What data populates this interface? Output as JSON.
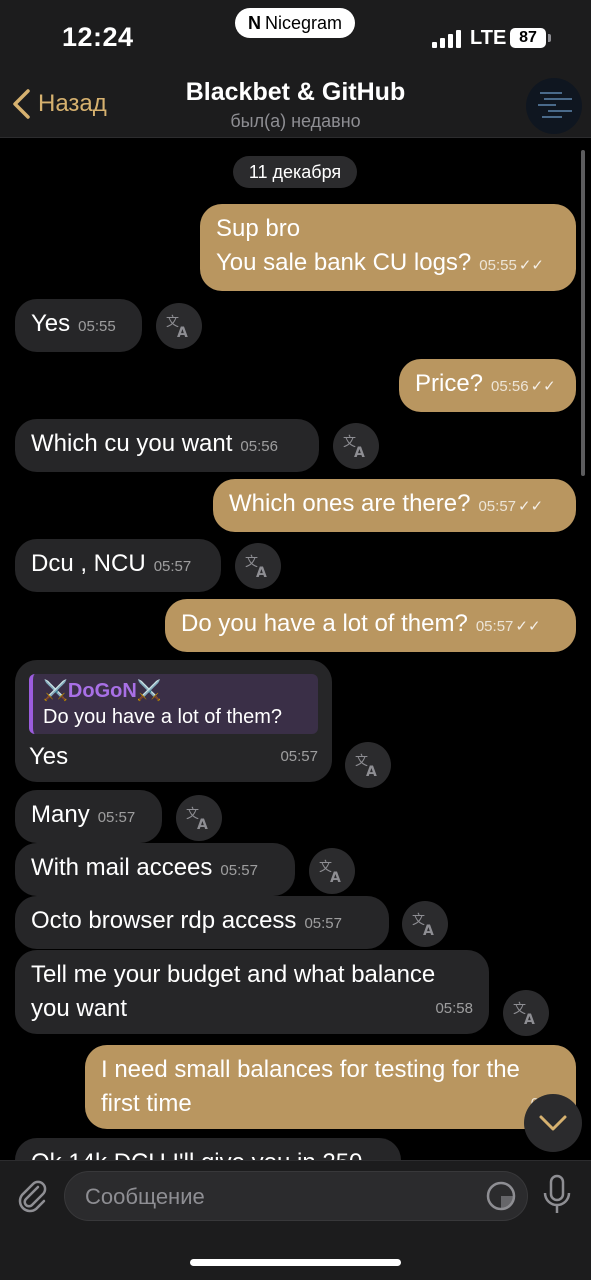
{
  "status_bar": {
    "time": "12:24",
    "app_badge": "Nicegram",
    "network": "LTE",
    "battery": "87"
  },
  "header": {
    "back_label": "Назад",
    "title": "Blackbet & GitHub",
    "subtitle": "был(а) недавно"
  },
  "date_chip": "11 декабря",
  "messages": [
    {
      "dir": "out",
      "lines": [
        "Sup bro",
        "You sale bank CU logs?"
      ],
      "time": "05:55"
    },
    {
      "dir": "in",
      "text": "Yes",
      "time": "05:55"
    },
    {
      "dir": "out",
      "text": "Price?",
      "time": "05:56"
    },
    {
      "dir": "in",
      "text": "Which cu you want",
      "time": "05:56"
    },
    {
      "dir": "out",
      "text": "Which ones are there?",
      "time": "05:57"
    },
    {
      "dir": "in",
      "text": "Dcu , NCU",
      "time": "05:57"
    },
    {
      "dir": "out",
      "text": "Do you have a lot of them?",
      "time": "05:57"
    },
    {
      "dir": "in",
      "reply_name": "⚔️DoGoN⚔️",
      "reply_text": "Do you have a lot of them?",
      "text": "Yes",
      "time": "05:57"
    },
    {
      "dir": "in",
      "text": "Many",
      "time": "05:57"
    },
    {
      "dir": "in",
      "text": "With mail accees",
      "time": "05:57"
    },
    {
      "dir": "in",
      "text": "Octo browser rdp access",
      "time": "05:57"
    },
    {
      "dir": "in",
      "lines": [
        "Tell me your budget and what balance",
        "you want"
      ],
      "time": "05:58"
    },
    {
      "dir": "out",
      "lines": [
        "I need small balances for testing for the",
        "first time"
      ],
      "time": "05:5"
    },
    {
      "dir": "in",
      "text": "Ok 14k DCU I'll give you in 250"
    }
  ],
  "input": {
    "placeholder": "Сообщение"
  },
  "icons": [
    "chevron-left-icon",
    "translate-icon",
    "paperclip-icon",
    "sticker-icon",
    "microphone-icon",
    "chevron-down-icon",
    "double-check-icon"
  ]
}
